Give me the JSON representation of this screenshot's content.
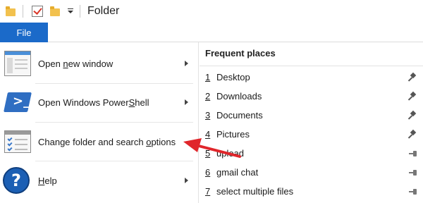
{
  "title_bar": {
    "title": "Folder",
    "icons": [
      "folder-icon",
      "properties-check-icon",
      "new-folder-icon",
      "customize-quick-access-icon"
    ]
  },
  "ribbon": {
    "file_tab": "File"
  },
  "left_menu": {
    "items": [
      {
        "label": "Open new window",
        "icon": "window-icon",
        "has_submenu": true
      },
      {
        "label": "Open Windows PowerShell",
        "icon": "powershell-icon",
        "has_submenu": true
      },
      {
        "label": "Change folder and search options",
        "icon": "options-icon",
        "has_submenu": false
      },
      {
        "label": "Help",
        "icon": "help-icon",
        "has_submenu": true
      }
    ]
  },
  "frequent_places": {
    "title": "Frequent places",
    "items": [
      {
        "num": "1",
        "label": "Desktop",
        "pinned": true
      },
      {
        "num": "2",
        "label": "Downloads",
        "pinned": true
      },
      {
        "num": "3",
        "label": "Documents",
        "pinned": true
      },
      {
        "num": "4",
        "label": "Pictures",
        "pinned": true
      },
      {
        "num": "5",
        "label": "upload",
        "pinned": false
      },
      {
        "num": "6",
        "label": "gmail chat",
        "pinned": false
      },
      {
        "num": "7",
        "label": "select multiple files",
        "pinned": false
      }
    ]
  },
  "colors": {
    "accent": "#1b6ac9",
    "annotation_arrow": "#e0262b"
  }
}
